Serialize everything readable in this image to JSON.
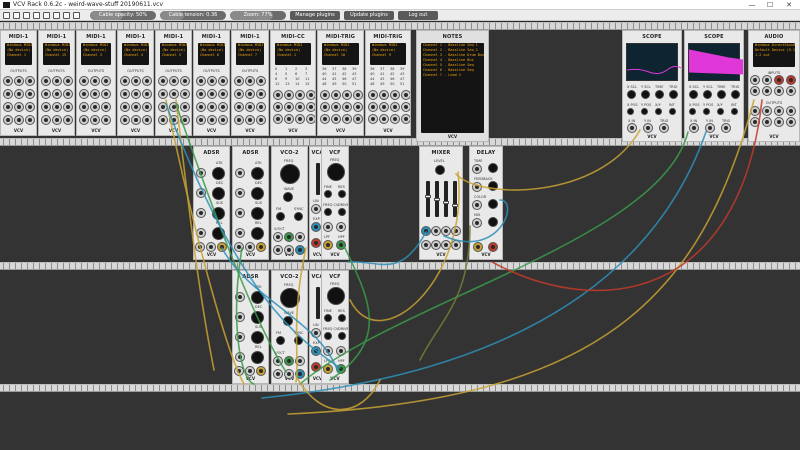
{
  "window": {
    "title": "VCV Rack 0.6.2c - weird-wave-stuff 20190611.vcv",
    "controls": [
      "—",
      "☐",
      "✕"
    ]
  },
  "toolbar": {
    "icons": [
      "new-file-icon",
      "open-file-icon",
      "save-icon",
      "save-as-icon",
      "revert-icon",
      "disconnect-icon",
      "power-meter-icon",
      "fullscreen-icon"
    ],
    "cable_opacity": {
      "label": "Cable opacity: 50%",
      "value": 0.5
    },
    "cable_tension": {
      "label": "Cable tension: 0.36",
      "value": 0.36
    },
    "zoom": {
      "label": "Zoom: 77%",
      "value": 0.77
    },
    "buttons": {
      "manage": "Manage plugins",
      "update": "Update plugins",
      "logout": "Log out"
    }
  },
  "brand": "VCV",
  "rows": {
    "top": [
      {
        "name": "MIDI-1",
        "lines": [
          "Windows MIDI",
          "(No device)",
          "Channel 1"
        ],
        "section": "OUTPUTS"
      },
      {
        "name": "MIDI-1",
        "lines": [
          "Windows MIDI",
          "(No device)",
          "Channel 15"
        ],
        "section": "OUTPUTS"
      },
      {
        "name": "MIDI-1",
        "lines": [
          "Windows MIDI",
          "(No device)",
          "Channel 3"
        ],
        "section": "OUTPUTS"
      },
      {
        "name": "MIDI-1",
        "lines": [
          "Windows MIDI",
          "(No device)",
          "Channel 4"
        ],
        "section": "OUTPUTS"
      },
      {
        "name": "MIDI-1",
        "lines": [
          "Windows MIDI",
          "(No device)",
          "Channel 5"
        ],
        "section": "OUTPUTS"
      },
      {
        "name": "MIDI-1",
        "lines": [
          "Windows MIDI",
          "(No device)",
          "Channel 6"
        ],
        "section": "OUTPUTS"
      },
      {
        "name": "MIDI-1",
        "lines": [
          "Windows MIDI",
          "(No device)",
          "Channel 7"
        ],
        "section": "OUTPUTS"
      },
      {
        "name": "MIDI-CC",
        "lines": [
          "Windows MIDI",
          "(No device)",
          "Channel 1"
        ],
        "section": ""
      },
      {
        "name": "MIDI-TRIG",
        "lines": [
          "Windows MIDI",
          "(No device)",
          "Channel 10"
        ],
        "section": ""
      },
      {
        "name": "MIDI-TRIG",
        "lines": [
          "Windows MIDI",
          "(No device)",
          "Channel 9"
        ],
        "section": ""
      }
    ],
    "cc_grid": [
      "0",
      "1",
      "2",
      "3",
      "4",
      "5",
      "6",
      "7",
      "8",
      "9",
      "10",
      "11",
      "12",
      "13",
      "14",
      "15"
    ],
    "trig_grid": [
      "36",
      "37",
      "38",
      "39",
      "40",
      "41",
      "42",
      "43",
      "44",
      "45",
      "46",
      "47",
      "48",
      "49",
      "50",
      "51"
    ],
    "notes": {
      "name": "NOTES",
      "lines": [
        "Channel 1 - Bassline Seq 1",
        "Channel 2 - Bassline Seq 2",
        "Channel 3 - Bassline Drum Bus",
        "Channel 4 - Bassline Bus",
        "Channel 5 - Bassline Seq",
        "Channel 6 - Bassline Seq",
        "Channel 7 - Lead 2"
      ]
    },
    "scopes": [
      {
        "name": "SCOPE",
        "labels": [
          "X SCL",
          "Y SCL",
          "TIME",
          "TRIG",
          "X POS",
          "Y POS",
          "X/Y",
          "INT",
          "X IN",
          "Y IN",
          "TRIG"
        ]
      },
      {
        "name": "SCOPE",
        "labels": [
          "X SCL",
          "Y SCL",
          "TIME",
          "TRIG",
          "X POS",
          "Y POS",
          "X/Y",
          "INT",
          "X IN",
          "Y IN",
          "TRIG"
        ]
      }
    ],
    "audio": {
      "name": "AUDIO",
      "lines": [
        "Windows DirectSound",
        "Default Device (5.1 ch)",
        "1-2 out"
      ],
      "inputs": "INPUTS",
      "outputs": "OUTPUTS"
    },
    "middle": [
      {
        "name": "ADSR",
        "labels": [
          "ATK",
          "DEC",
          "SUS",
          "REL"
        ]
      },
      {
        "name": "ADSR",
        "labels": [
          "ATK",
          "DEC",
          "SUS",
          "REL"
        ]
      },
      {
        "name": "VCO-2",
        "labels": [
          "FREQ",
          "WAVE",
          "FM",
          "SYNC",
          "V/OCT"
        ]
      },
      {
        "name": "VCA",
        "labels": [
          "LIN",
          "EXP"
        ]
      },
      {
        "name": "VCF",
        "labels": [
          "FREQ",
          "FINE",
          "RES",
          "FREQ CV",
          "DRIVE",
          "LPF",
          "HPF"
        ]
      },
      {
        "name": "MIXER",
        "labels": [
          "LEVEL",
          "CH 1",
          "CH 2",
          "CH 3",
          "CH 4"
        ]
      },
      {
        "name": "DELAY",
        "labels": [
          "TIME",
          "FEEDBACK",
          "COLOR",
          "MIX"
        ]
      }
    ],
    "bottom": [
      {
        "name": "ADSR",
        "labels": [
          "ATK",
          "DEC",
          "SUS",
          "REL"
        ]
      },
      {
        "name": "VCO-2",
        "labels": [
          "FREQ",
          "WAVE",
          "FM",
          "SYNC",
          "V/OCT"
        ]
      },
      {
        "name": "VCA",
        "labels": [
          "LIN",
          "EXP"
        ]
      },
      {
        "name": "VCF",
        "labels": [
          "FREQ",
          "FINE",
          "RES",
          "FREQ CV",
          "DRIVE",
          "LPF",
          "HPF"
        ]
      }
    ]
  },
  "colors": {
    "rack": "#333333",
    "panel": "#e9e9e9",
    "screen_text": "#f2a60d",
    "cables": [
      "#c8a233",
      "#2e8fb8",
      "#3a9a4a",
      "#c0392b",
      "#7a7a3a"
    ],
    "scope_trace": "#e038d8"
  }
}
